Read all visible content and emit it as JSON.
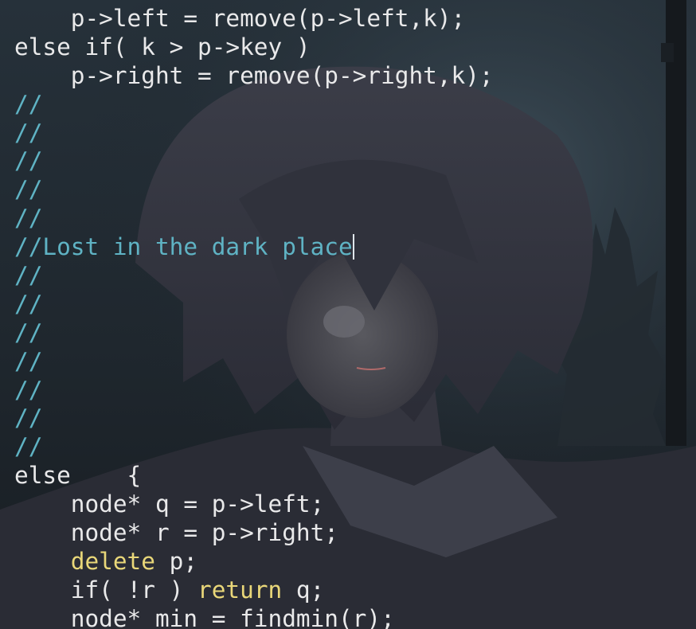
{
  "editor": {
    "lines": [
      {
        "indent": "    ",
        "segments": [
          {
            "text": "p->left = remove(p->left,k);",
            "kind": "code"
          }
        ]
      },
      {
        "indent": "",
        "segments": [
          {
            "text": "else if( k > p->key )",
            "kind": "code"
          }
        ]
      },
      {
        "indent": "    ",
        "segments": [
          {
            "text": "p->right = remove(p->right,k);",
            "kind": "code"
          }
        ]
      },
      {
        "indent": "",
        "segments": [
          {
            "text": "//",
            "kind": "comment"
          }
        ]
      },
      {
        "indent": "",
        "segments": [
          {
            "text": "//",
            "kind": "comment"
          }
        ]
      },
      {
        "indent": "",
        "segments": [
          {
            "text": "//",
            "kind": "comment"
          }
        ]
      },
      {
        "indent": "",
        "segments": [
          {
            "text": "//",
            "kind": "comment"
          }
        ]
      },
      {
        "indent": "",
        "segments": [
          {
            "text": "//",
            "kind": "comment"
          }
        ]
      },
      {
        "indent": "",
        "segments": [
          {
            "text": "//Lost in the dark place",
            "kind": "comment"
          }
        ],
        "cursor": true
      },
      {
        "indent": "",
        "segments": [
          {
            "text": "//",
            "kind": "comment"
          }
        ]
      },
      {
        "indent": "",
        "segments": [
          {
            "text": "//",
            "kind": "comment"
          }
        ]
      },
      {
        "indent": "",
        "segments": [
          {
            "text": "//",
            "kind": "comment"
          }
        ]
      },
      {
        "indent": "",
        "segments": [
          {
            "text": "//",
            "kind": "comment"
          }
        ]
      },
      {
        "indent": "",
        "segments": [
          {
            "text": "//",
            "kind": "comment"
          }
        ]
      },
      {
        "indent": "",
        "segments": [
          {
            "text": "//",
            "kind": "comment"
          }
        ]
      },
      {
        "indent": "",
        "segments": [
          {
            "text": "//",
            "kind": "comment"
          }
        ]
      },
      {
        "indent": "",
        "segments": [
          {
            "text": "else    {",
            "kind": "code"
          }
        ]
      },
      {
        "indent": "    ",
        "segments": [
          {
            "text": "node* q = p->left;",
            "kind": "code"
          }
        ]
      },
      {
        "indent": "    ",
        "segments": [
          {
            "text": "node* r = p->right;",
            "kind": "code"
          }
        ]
      },
      {
        "indent": "    ",
        "segments": [
          {
            "text": "delete",
            "kind": "keyword"
          },
          {
            "text": " p;",
            "kind": "code"
          }
        ]
      },
      {
        "indent": "    ",
        "segments": [
          {
            "text": "if( !r ) ",
            "kind": "code"
          },
          {
            "text": "return",
            "kind": "keyword"
          },
          {
            "text": " q;",
            "kind": "code"
          }
        ]
      },
      {
        "indent": "    ",
        "segments": [
          {
            "text": "node* min = findmin(r);",
            "kind": "code"
          }
        ]
      }
    ]
  },
  "theme": {
    "code_color": "#e9e9ea",
    "comment_color": "#5fb3c4",
    "keyword_color": "#e9d779",
    "background_color": "#1f272e"
  }
}
